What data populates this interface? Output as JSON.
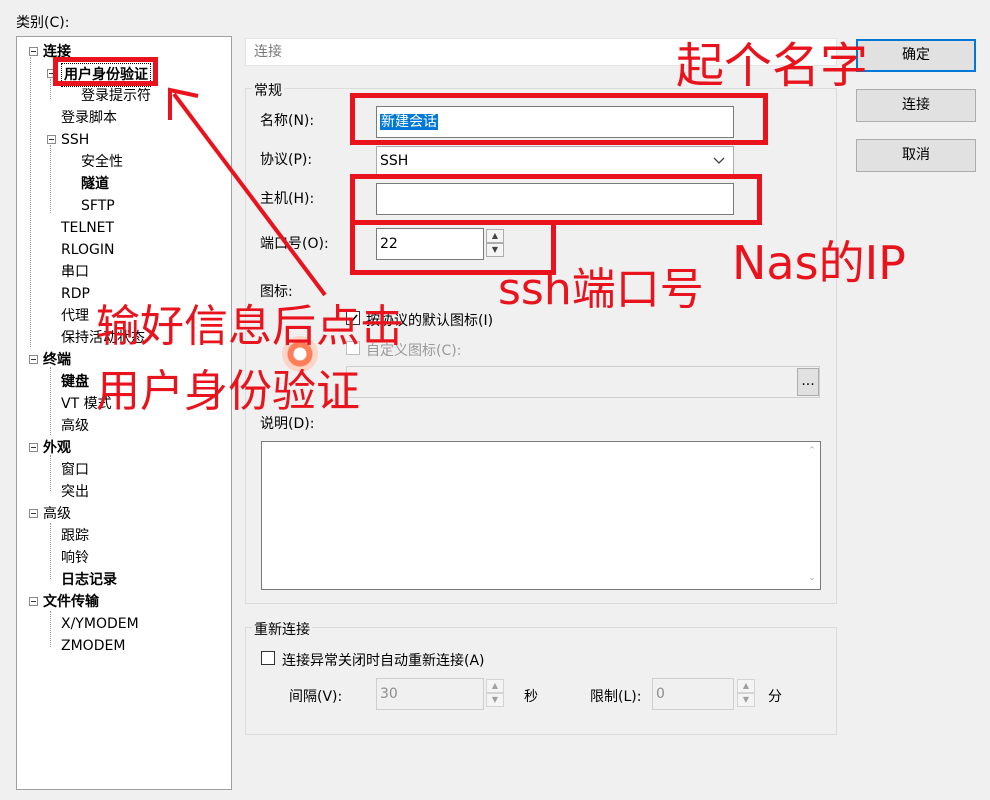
{
  "category_label": "类别(C):",
  "tree": {
    "connection": "连接",
    "user_auth": "用户身份验证",
    "login_prompt": "登录提示符",
    "login_script": "登录脚本",
    "ssh": "SSH",
    "security": "安全性",
    "tunnel": "隧道",
    "sftp": "SFTP",
    "telnet": "TELNET",
    "rlogin": "RLOGIN",
    "serial": "串口",
    "rdp": "RDP",
    "proxy": "代理",
    "keepalive": "保持活动状态",
    "terminal": "终端",
    "keyboard": "键盘",
    "vt_mode": "VT 模式",
    "advanced_term": "高级",
    "appearance": "外观",
    "window": "窗口",
    "highlight": "突出",
    "advanced": "高级",
    "trace": "跟踪",
    "bell": "响铃",
    "log": "日志记录",
    "file_transfer": "文件传输",
    "xymodem": "X/YMODEM",
    "zmodem": "ZMODEM"
  },
  "header": "连接",
  "general": {
    "title": "常规",
    "name_label": "名称(N):",
    "name_value": "新建会话",
    "protocol_label": "协议(P):",
    "protocol_value": "SSH",
    "host_label": "主机(H):",
    "host_value": "",
    "port_label": "端口号(O):",
    "port_value": "22",
    "icon_label": "图标:",
    "default_icon_label": "按协议的默认图标(I)",
    "custom_icon_label": "自定义图标(C):",
    "browse_label": "...",
    "description_label": "说明(D):",
    "description_value": ""
  },
  "reconnect": {
    "title": "重新连接",
    "auto_label": "连接异常关闭时自动重新连接(A)",
    "interval_label": "间隔(V):",
    "interval_value": "30",
    "sec_unit": "秒",
    "limit_label": "限制(L):",
    "limit_value": "0",
    "min_unit": "分"
  },
  "buttons": {
    "ok": "确定",
    "connect": "连接",
    "cancel": "取消"
  },
  "annotations": {
    "name_note": "起个名字",
    "nas_ip": "Nas的IP",
    "ssh_port": "ssh端口号",
    "instruction_line1": "输好信息后点击",
    "instruction_line2": "用户身份验证"
  },
  "colors": {
    "annotation": "#e8131c",
    "selection": "#0078d7"
  }
}
